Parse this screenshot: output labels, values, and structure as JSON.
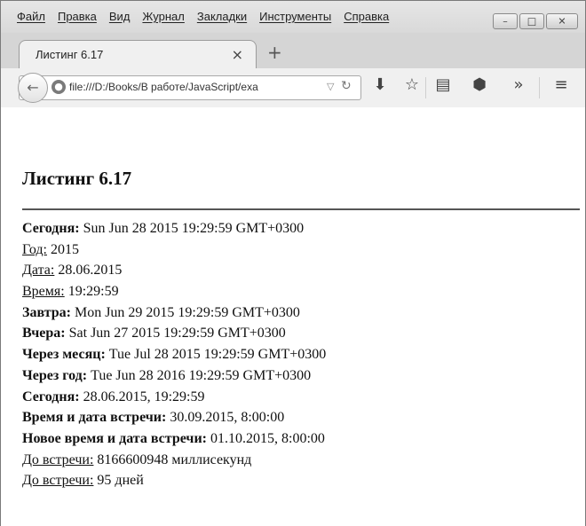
{
  "menubar": [
    "Файл",
    "Правка",
    "Вид",
    "Журнал",
    "Закладки",
    "Инструменты",
    "Справка"
  ],
  "tab": {
    "title": "Листинг 6.17",
    "close": "×",
    "new_tab": "+"
  },
  "urlbar": {
    "url": "file:///D:/Books/В работе/JavaScript/exa"
  },
  "icons": {
    "back": "back-arrow-icon",
    "site": "globe-icon",
    "dropdown": "triangle-down-icon",
    "reload": "reload-icon",
    "download": "download-arrow-icon",
    "bookmark": "star-icon",
    "reading": "reading-list-icon",
    "pocket": "pocket-icon",
    "overflow": "chevron-double-right-icon",
    "menu": "hamburger-menu-icon"
  },
  "page": {
    "title": "Листинг 6.17",
    "lines": [
      {
        "label": "Сегодня:",
        "style": "bold",
        "value": " Sun Jun 28 2015 19:29:59 GMT+0300"
      },
      {
        "label": "Год:",
        "style": "underline",
        "value": " 2015"
      },
      {
        "label": "Дата:",
        "style": "underline",
        "value": " 28.06.2015"
      },
      {
        "label": "Время:",
        "style": "underline",
        "value": " 19:29:59"
      },
      {
        "label": "Завтра:",
        "style": "bold",
        "value": " Mon Jun 29 2015 19:29:59 GMT+0300"
      },
      {
        "label": "Вчера:",
        "style": "bold",
        "value": " Sat Jun 27 2015 19:29:59 GMT+0300"
      },
      {
        "label": "Через месяц:",
        "style": "bold",
        "value": " Tue Jul 28 2015 19:29:59 GMT+0300"
      },
      {
        "label": "Через год:",
        "style": "bold",
        "value": " Tue Jun 28 2016 19:29:59 GMT+0300"
      },
      {
        "label": "Сегодня:",
        "style": "bold",
        "value": " 28.06.2015, 19:29:59"
      },
      {
        "label": "Время и дата встречи:",
        "style": "bold",
        "value": " 30.09.2015, 8:00:00"
      },
      {
        "label": "Новое время и дата встречи:",
        "style": "bold",
        "value": " 01.10.2015, 8:00:00"
      },
      {
        "label": "До встречи:",
        "style": "underline",
        "value": " 8166600948 миллисекунд"
      },
      {
        "label": "До встречи:",
        "style": "underline",
        "value": " 95 дней"
      }
    ]
  }
}
